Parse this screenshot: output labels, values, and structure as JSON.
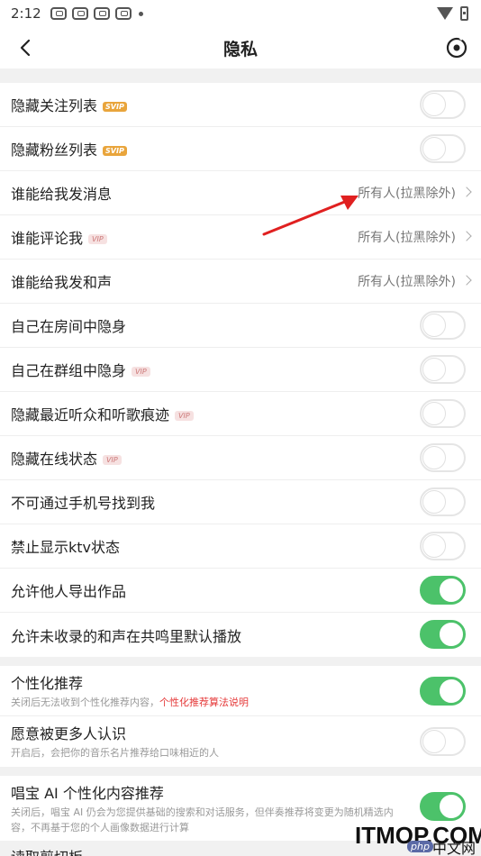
{
  "status_bar": {
    "time": "2:12"
  },
  "header": {
    "title": "隐私",
    "back_icon": "chevron-left-icon",
    "right_icon": "target-icon"
  },
  "section1": {
    "rows": [
      {
        "label": "隐藏关注列表",
        "badge": "SVIP",
        "type": "toggle",
        "on": false
      },
      {
        "label": "隐藏粉丝列表",
        "badge": "SVIP",
        "type": "toggle",
        "on": false
      },
      {
        "label": "谁能给我发消息",
        "type": "select",
        "value": "所有人(拉黑除外)"
      },
      {
        "label": "谁能评论我",
        "badge": "VIP",
        "type": "select",
        "value": "所有人(拉黑除外)"
      },
      {
        "label": "谁能给我发和声",
        "type": "select",
        "value": "所有人(拉黑除外)"
      },
      {
        "label": "自己在房间中隐身",
        "type": "toggle",
        "on": false
      },
      {
        "label": "自己在群组中隐身",
        "badge": "VIP",
        "type": "toggle",
        "on": false
      },
      {
        "label": "隐藏最近听众和听歌痕迹",
        "badge": "VIP",
        "type": "toggle",
        "on": false
      },
      {
        "label": "隐藏在线状态",
        "badge": "VIP",
        "type": "toggle",
        "on": false
      },
      {
        "label": "不可通过手机号找到我",
        "type": "toggle",
        "on": false
      },
      {
        "label": "禁止显示ktv状态",
        "type": "toggle",
        "on": false
      },
      {
        "label": "允许他人导出作品",
        "type": "toggle",
        "on": true
      },
      {
        "label": "允许未收录的和声在共鸣里默认播放",
        "type": "toggle",
        "on": true
      }
    ]
  },
  "section2": {
    "rows": [
      {
        "label": "个性化推荐",
        "sub": "关闭后无法收到个性化推荐内容，",
        "sub_link": "个性化推荐算法说明",
        "on": true
      },
      {
        "label": "愿意被更多人认识",
        "sub": "开启后，会把你的音乐名片推荐给口味相近的人",
        "on": false
      }
    ]
  },
  "section3": {
    "label": "唱宝 AI 个性化内容推荐",
    "sub": "关闭后，唱宝 AI 仍会为您提供基础的搜索和对话服务，但伴奏推荐将变更为随机精选内容，不再基于您的个人画像数据进行计算",
    "on": true
  },
  "partial_row": "读取剪切板",
  "watermark": {
    "text": "ITMOP.COM",
    "php_badge": "php",
    "php_text": "中文网"
  },
  "colors": {
    "toggle_on": "#4cc26a",
    "svip_badge": "#e9a53c",
    "link": "#e53a3a",
    "arrow": "#e02020"
  }
}
